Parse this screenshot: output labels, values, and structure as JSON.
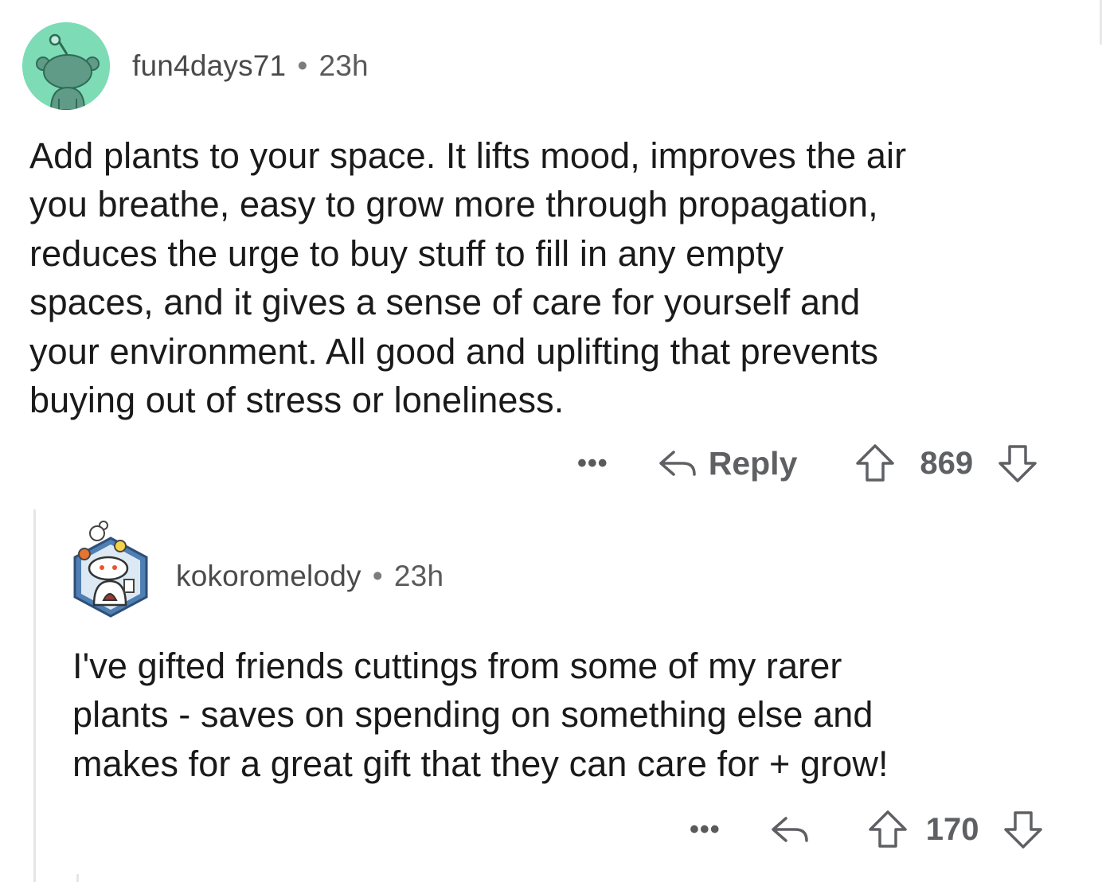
{
  "comments": [
    {
      "username": "fun4days71",
      "separator": "•",
      "time": "23h",
      "body_lines": [
        "Add plants to your space. It lifts mood, improves the air",
        "you breathe, easy to grow more through propagation,",
        "reduces the urge to buy stuff to fill in any empty",
        "spaces, and it gives a sense of care for yourself and",
        "your environment. All good and uplifting that prevents",
        "buying out of stress or loneliness."
      ],
      "more_label": "•••",
      "reply_label": "Reply",
      "score": "869",
      "avatar_bg": "#7ddcb6"
    },
    {
      "username": "kokoromelody",
      "separator": "•",
      "time": "23h",
      "body_lines": [
        "I've gifted friends cuttings from some of my rarer",
        "plants - saves on spending on something else and",
        "makes for a great gift that they can care for + grow!"
      ],
      "more_label": "•••",
      "score": "170"
    }
  ],
  "icons": {
    "reply": "reply-arrow-icon",
    "upvote": "upvote-arrow-icon",
    "downvote": "downvote-arrow-icon",
    "more": "more-options-icon"
  },
  "colors": {
    "text": "#1a1a1b",
    "meta": "#4c4c4c",
    "action": "#5f6064",
    "thread_line": "#e6e6e6"
  }
}
